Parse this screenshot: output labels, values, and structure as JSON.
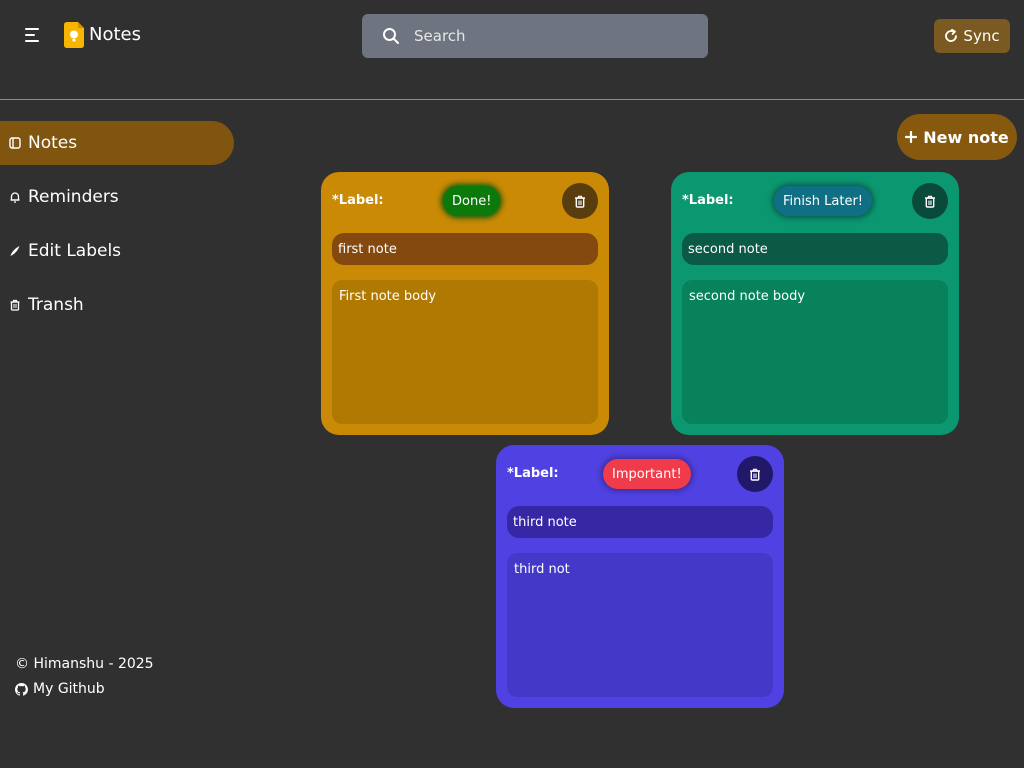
{
  "header": {
    "app_title": "Notes",
    "search_placeholder": "Search",
    "sync_label": "Sync"
  },
  "sidebar": {
    "items": [
      {
        "label": "Notes",
        "icon": "note-icon",
        "active": true
      },
      {
        "label": "Reminders",
        "icon": "bell-icon",
        "active": false
      },
      {
        "label": "Edit Labels",
        "icon": "pen-icon",
        "active": false
      },
      {
        "label": "Transh",
        "icon": "trash-icon",
        "active": false
      }
    ],
    "footer": {
      "copyright": "© Himanshu - 2025",
      "github_link": "My Github"
    }
  },
  "new_note_label": "New note",
  "notes": [
    {
      "label_text": "*Label:",
      "chip": "Done!",
      "title": "first note",
      "body": "First note body",
      "colors": {
        "card": "#cb8a05",
        "chip": "#0b7a0b",
        "title_bg": "#84490f",
        "body_bg": "#b07902",
        "delete_bg": "#5a3d0f"
      }
    },
    {
      "label_text": "*Label:",
      "chip": "Finish Later!",
      "title": "second note",
      "body": "second note body",
      "colors": {
        "card": "#0b9870",
        "chip": "#0f6f85",
        "title_bg": "#0b5a45",
        "body_bg": "#08825a",
        "delete_bg": "#0a4a3a"
      }
    },
    {
      "label_text": "*Label:",
      "chip": "Important!",
      "title": "third note",
      "body": "third not",
      "colors": {
        "card": "#5042e2",
        "chip": "#ef3b4a",
        "title_bg": "#3628a5",
        "body_bg": "#4438c8",
        "delete_bg": "#22186a"
      }
    }
  ],
  "colors": {
    "background": "#303030",
    "accent": "#805510",
    "search_bg": "#6f7580"
  }
}
